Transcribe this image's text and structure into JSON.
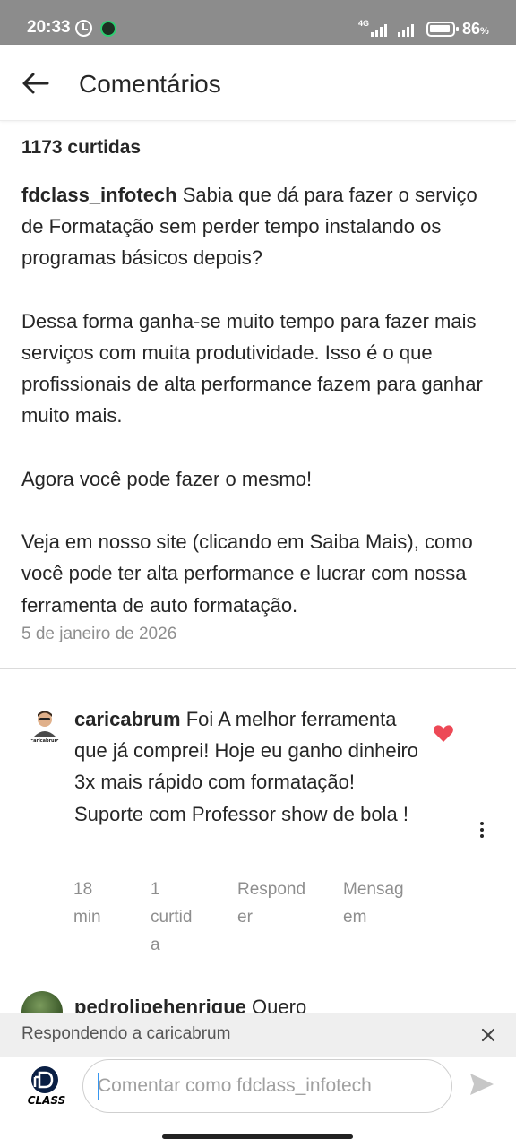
{
  "status_bar": {
    "time": "20:33",
    "network": "4G",
    "battery": "86",
    "battery_unit": "%"
  },
  "header": {
    "title": "Comentários"
  },
  "post": {
    "likes": "1173 curtidas",
    "author": "fdclass_infotech",
    "caption": " Sabia que dá para fazer o serviço de Formatação sem perder tempo instalando os programas básicos depois?\n\nDessa forma ganha-se muito tempo para fazer mais serviços com muita produtividade. Isso é o que profissionais de alta performance fazem para ganhar muito mais.\n\nAgora você pode fazer o mesmo!\n\nVeja em nosso site (clicando em Saiba Mais), como você pode ter alta performance e lucrar com nossa ferramenta de auto formatação.",
    "date": "5 de janeiro de 2026"
  },
  "comments": [
    {
      "author": "caricabrum",
      "avatar_label": "caricabrum",
      "text": " Foi A melhor ferramenta que já comprei! Hoje eu ganho dinheiro 3x mais rápido com formatação! Suporte  com Professor show de bola !",
      "time": "18\nmin",
      "likes": "1\ncurtid\na",
      "reply_label": "Respond\ner",
      "message_label": "Mensag\nem",
      "liked": true
    },
    {
      "author": "pedrolipehenrique",
      "text": " Quero"
    }
  ],
  "reply_bar": {
    "text": "Respondendo a caricabrum"
  },
  "composer": {
    "placeholder": "Comentar como fdclass_infotech",
    "avatar_label": "CLASS"
  },
  "colors": {
    "status_bar": "#8c8c8c",
    "like_heart": "#ed4956",
    "muted_text": "#8e8e8e"
  }
}
